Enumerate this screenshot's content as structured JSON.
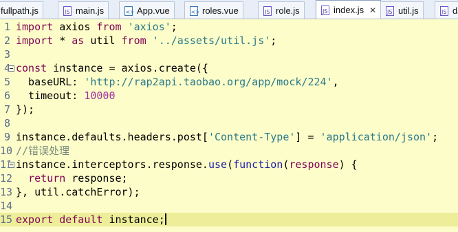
{
  "tabs": [
    {
      "label": "fullpath.js",
      "type": "js"
    },
    {
      "label": "main.js",
      "type": "js"
    },
    {
      "label": "App.vue",
      "type": "vue"
    },
    {
      "label": "roles.vue",
      "type": "vue"
    },
    {
      "label": "role.js",
      "type": "js"
    },
    {
      "label": "index.js",
      "type": "js",
      "active": true,
      "close": "✕"
    },
    {
      "label": "util.js",
      "type": "js"
    },
    {
      "label": "da",
      "type": "js"
    }
  ],
  "line_numbers": [
    "1",
    "2",
    "3",
    "4",
    "5",
    "6",
    "7",
    "8",
    "9",
    "10",
    "11",
    "12",
    "13",
    "14",
    "15"
  ],
  "code": {
    "l1": {
      "kw": "import",
      "a": " axios ",
      "kw2": "from",
      "sp": " ",
      "str": "'axios'",
      "end": ";"
    },
    "l2": {
      "kw": "import",
      "a": " * ",
      "kw2": "as",
      "b": " util ",
      "kw3": "from",
      "sp": " ",
      "str": "'../assets/util.js'",
      "end": ";"
    },
    "l4": {
      "kw": "const",
      "a": " instance = axios.create({"
    },
    "l5": {
      "a": "  baseURL: ",
      "str": "'http://rap2api.taobao.org/app/mock/224'",
      "end": ","
    },
    "l6": {
      "a": "  timeout: ",
      "num": "10000"
    },
    "l7": {
      "a": "});"
    },
    "l9": {
      "a": "instance.defaults.headers.post[",
      "str": "'Content-Type'",
      "b": "] = ",
      "str2": "'application/json'",
      "end": ";"
    },
    "l10": {
      "cmt": "//错误处理"
    },
    "l11": {
      "a": "instance.interceptors.response.",
      "kw": "use",
      "b": "(",
      "kw2": "function",
      "c": "(",
      "param": "response",
      "d": ") {"
    },
    "l12": {
      "a": "  ",
      "kw": "return",
      "b": " response;"
    },
    "l13": {
      "a": "}, util.catchError);"
    },
    "l15": {
      "kw": "export",
      "a": " ",
      "kw2": "default",
      "b": " instance;"
    }
  },
  "colors": {
    "background": "#fdfdc9",
    "current_line": "#eeee9a",
    "keyword": "#7f0055",
    "string": "#2a7a8c",
    "number": "#a030a0",
    "comment": "#7a8a7a"
  }
}
